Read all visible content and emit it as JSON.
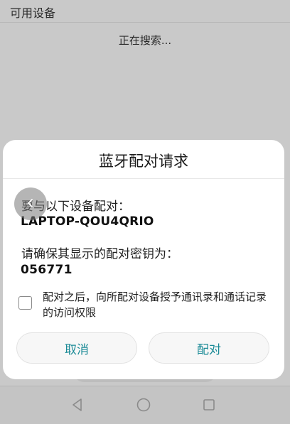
{
  "background": {
    "section_title": "可用设备",
    "status_text": "正在搜索..."
  },
  "dialog": {
    "title": "蓝牙配对请求",
    "prompt": "要与以下设备配对：",
    "device_name": "LAPTOP-QOU4QRIO",
    "confirm_prompt": "请确保其显示的配对密钥为：",
    "passkey": "056771",
    "checkbox_label": "配对之后，向所配对设备授予通讯录和通话记录的访问权限",
    "checkbox_checked": false,
    "cancel_label": "取消",
    "pair_label": "配对"
  },
  "nav_bar": {
    "icons": [
      "back-triangle-icon",
      "home-circle-icon",
      "recent-square-icon"
    ]
  },
  "colors": {
    "accent": "#1a8a96",
    "dim_background": "#c9c9c9",
    "dialog_background": "#ffffff"
  },
  "touch_indicator_icon": "chevron-left-icon"
}
